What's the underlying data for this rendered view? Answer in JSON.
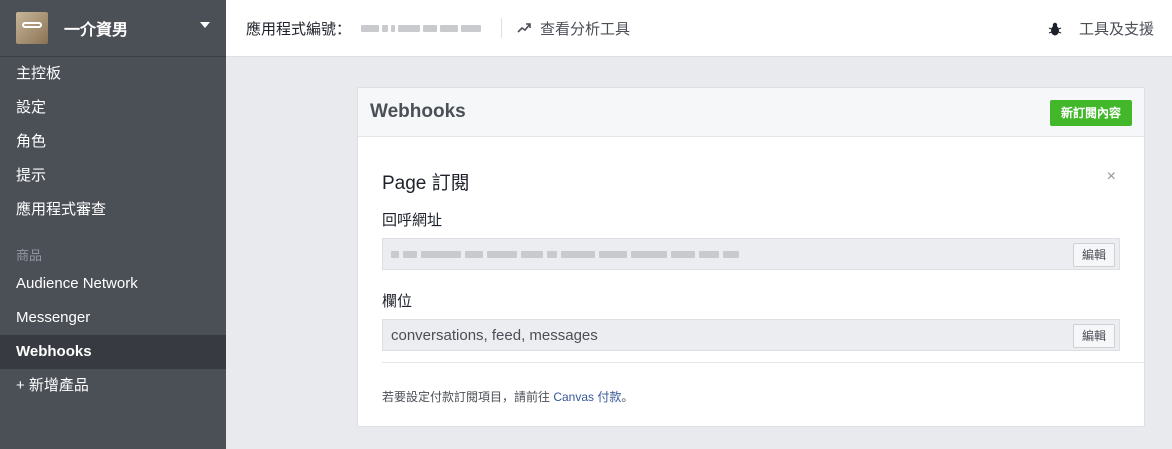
{
  "sidebar": {
    "app_name": "一介資男",
    "items": [
      {
        "label": "主控板"
      },
      {
        "label": "設定"
      },
      {
        "label": "角色"
      },
      {
        "label": "提示"
      },
      {
        "label": "應用程式審查"
      }
    ],
    "section_label": "商品",
    "products": [
      {
        "label": "Audience Network"
      },
      {
        "label": "Messenger"
      },
      {
        "label": "Webhooks",
        "active": true
      }
    ],
    "add_product_label": "+ 新增產品"
  },
  "topbar": {
    "app_id_label": "應用程式編號：",
    "analytics_label": "查看分析工具",
    "tools_label": "工具及支援"
  },
  "panel": {
    "title": "Webhooks",
    "new_subscription_label": "新訂閱內容",
    "subscription": {
      "title": "Page 訂閱",
      "close_label": "×",
      "callback_label": "回呼網址",
      "callback_edit_label": "編輯",
      "fields_label": "欄位",
      "fields_value": "conversations, feed, messages",
      "fields_edit_label": "編輯"
    },
    "footer": {
      "prefix": "若要設定付款訂閱項目，請前往 ",
      "link": "Canvas 付款",
      "suffix": "。"
    }
  },
  "colors": {
    "sidebar_bg": "#4b4f56",
    "accent_green": "#42b72a",
    "link_blue": "#365899"
  }
}
